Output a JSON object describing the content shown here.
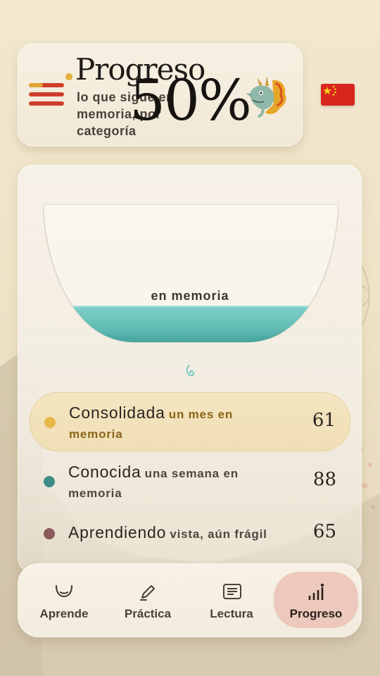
{
  "header": {
    "title": "Progreso",
    "subtitle": "lo que sigue en memoria, por categoría",
    "menu_icon": "menu-icon",
    "mascot_icon": "dragon-icon",
    "language_icon": "china-flag-icon"
  },
  "summary": {
    "percent_text": "50%",
    "caption": "en memoria",
    "fill_fraction": 0.5,
    "water_color": "#6cc7c0"
  },
  "categories": [
    {
      "name": "Consolidada",
      "description": "un mes en memoria",
      "count": "61",
      "dot_color": "#e6b84a",
      "desc_color": "#8a6418",
      "highlighted": true
    },
    {
      "name": "Conocida",
      "description": "una semana en memoria",
      "count": "88",
      "dot_color": "#3e8c88",
      "desc_color": "#4e4641",
      "highlighted": false
    },
    {
      "name": "Aprendiendo",
      "description": "vista, aún frágil",
      "count": "65",
      "dot_color": "#8c5a5a",
      "desc_color": "#4e4641",
      "highlighted": false
    }
  ],
  "nav": [
    {
      "label": "Aprende",
      "icon": "smile-icon",
      "active": false
    },
    {
      "label": "Práctica",
      "icon": "pencil-icon",
      "active": false
    },
    {
      "label": "Lectura",
      "icon": "reading-icon",
      "active": false
    },
    {
      "label": "Progreso",
      "icon": "bar-chart-icon",
      "active": true
    }
  ],
  "colors": {
    "accent_red": "#cf3d2b",
    "accent_gold": "#e3b13d",
    "active_tab": "#ecc9bc"
  }
}
